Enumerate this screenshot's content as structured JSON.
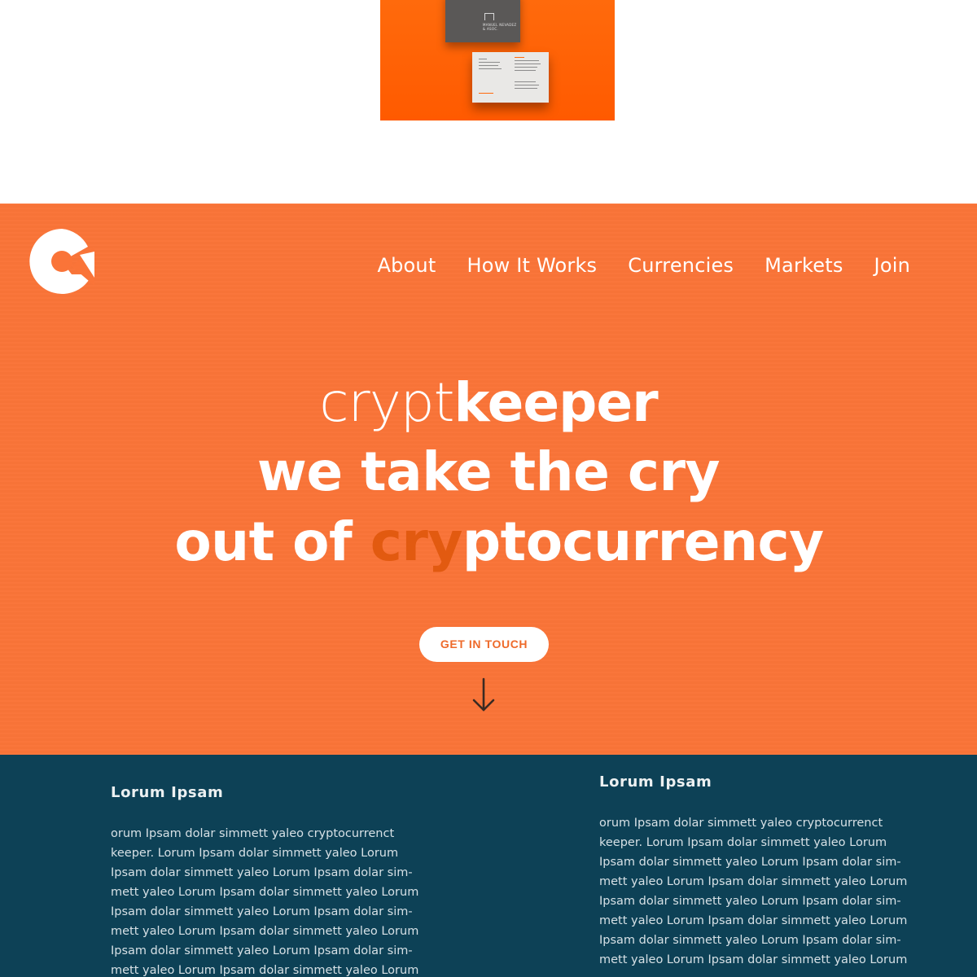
{
  "photo": {
    "dark_card_brand": "MANUEL NEVADEZ & ASOC."
  },
  "brand": {
    "logo_icon": "cryptkeeper-logo-icon",
    "accent_color": "#fa7438",
    "dark_color": "#0d4156"
  },
  "nav": {
    "items": [
      "About",
      "How It Works",
      "Currencies",
      "Markets",
      "Join"
    ]
  },
  "hero": {
    "brand_light": "crypt",
    "brand_bold": "keeper",
    "line2": "we take the cry",
    "line3_prefix": "out of ",
    "line3_accent": "cry",
    "line3_suffix": "ptocurrency",
    "cta_label": "GET IN TOUCH",
    "scroll_icon": "arrow-down-icon"
  },
  "info": {
    "left": {
      "title": "Lorum Ipsam",
      "body": "orum Ipsam dolar simmett yaleo cryptocurrenct\nkeeper. Lorum Ipsam dolar simmett yaleo Lorum\nIpsam dolar simmett yaleo Lorum Ipsam dolar sim-\nmett yaleo Lorum Ipsam dolar simmett yaleo Lorum\nIpsam dolar simmett yaleo Lorum Ipsam dolar sim-\nmett yaleo Lorum Ipsam dolar simmett yaleo Lorum\nIpsam dolar simmett yaleo Lorum Ipsam dolar sim-\nmett yaleo Lorum Ipsam dolar simmett yaleo Lorum"
    },
    "right": {
      "title": "Lorum Ipsam",
      "body": "orum Ipsam dolar simmett yaleo cryptocurrenct\nkeeper. Lorum Ipsam dolar simmett yaleo Lorum\nIpsam dolar simmett yaleo Lorum Ipsam dolar sim-\nmett yaleo Lorum Ipsam dolar simmett yaleo Lorum\nIpsam dolar simmett yaleo Lorum Ipsam dolar sim-\nmett yaleo Lorum Ipsam dolar simmett yaleo Lorum\nIpsam dolar simmett yaleo Lorum Ipsam dolar sim-\nmett yaleo Lorum Ipsam dolar simmett yaleo Lorum"
    }
  }
}
